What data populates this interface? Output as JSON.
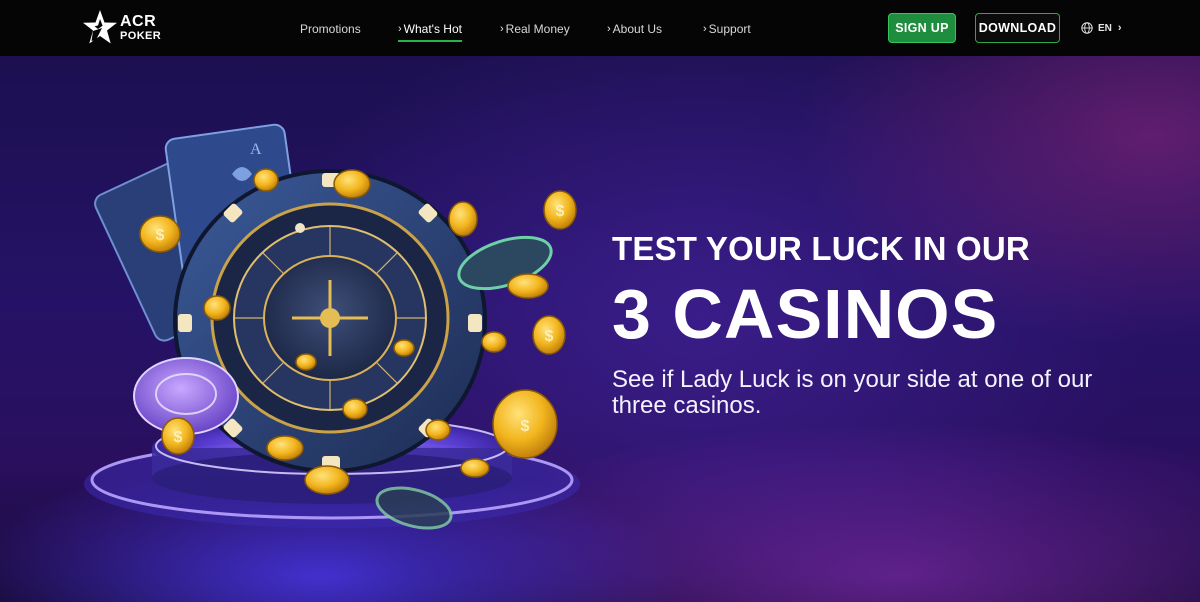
{
  "header": {
    "logo": {
      "top": "ACR",
      "bottom": "POKER",
      "icon": "star-logo-icon"
    },
    "nav": [
      {
        "label": "Promotions",
        "chevron": false,
        "active": false
      },
      {
        "label": "What's Hot",
        "chevron": true,
        "active": true
      },
      {
        "label": "Real Money",
        "chevron": true,
        "active": false
      },
      {
        "label": "About Us",
        "chevron": true,
        "active": false
      },
      {
        "label": "Support",
        "chevron": true,
        "active": false
      }
    ],
    "signup_label": "SIGN UP",
    "download_label": "DOWNLOAD",
    "language": "EN",
    "language_icon": "globe-icon"
  },
  "hero": {
    "title_top": "TEST YOUR LUCK IN OUR",
    "title_big": "3 CASINOS",
    "subtitle": "See if Lady Luck is on your side at one of our three casinos.",
    "art": "roulette-wheel-with-poker-chips-cards-and-gold-coins"
  },
  "colors": {
    "accent_green": "#27b24a",
    "signup_bg": "#1e8e3e",
    "hero_purple": "#251266",
    "coin_gold": "#f2b51d"
  }
}
